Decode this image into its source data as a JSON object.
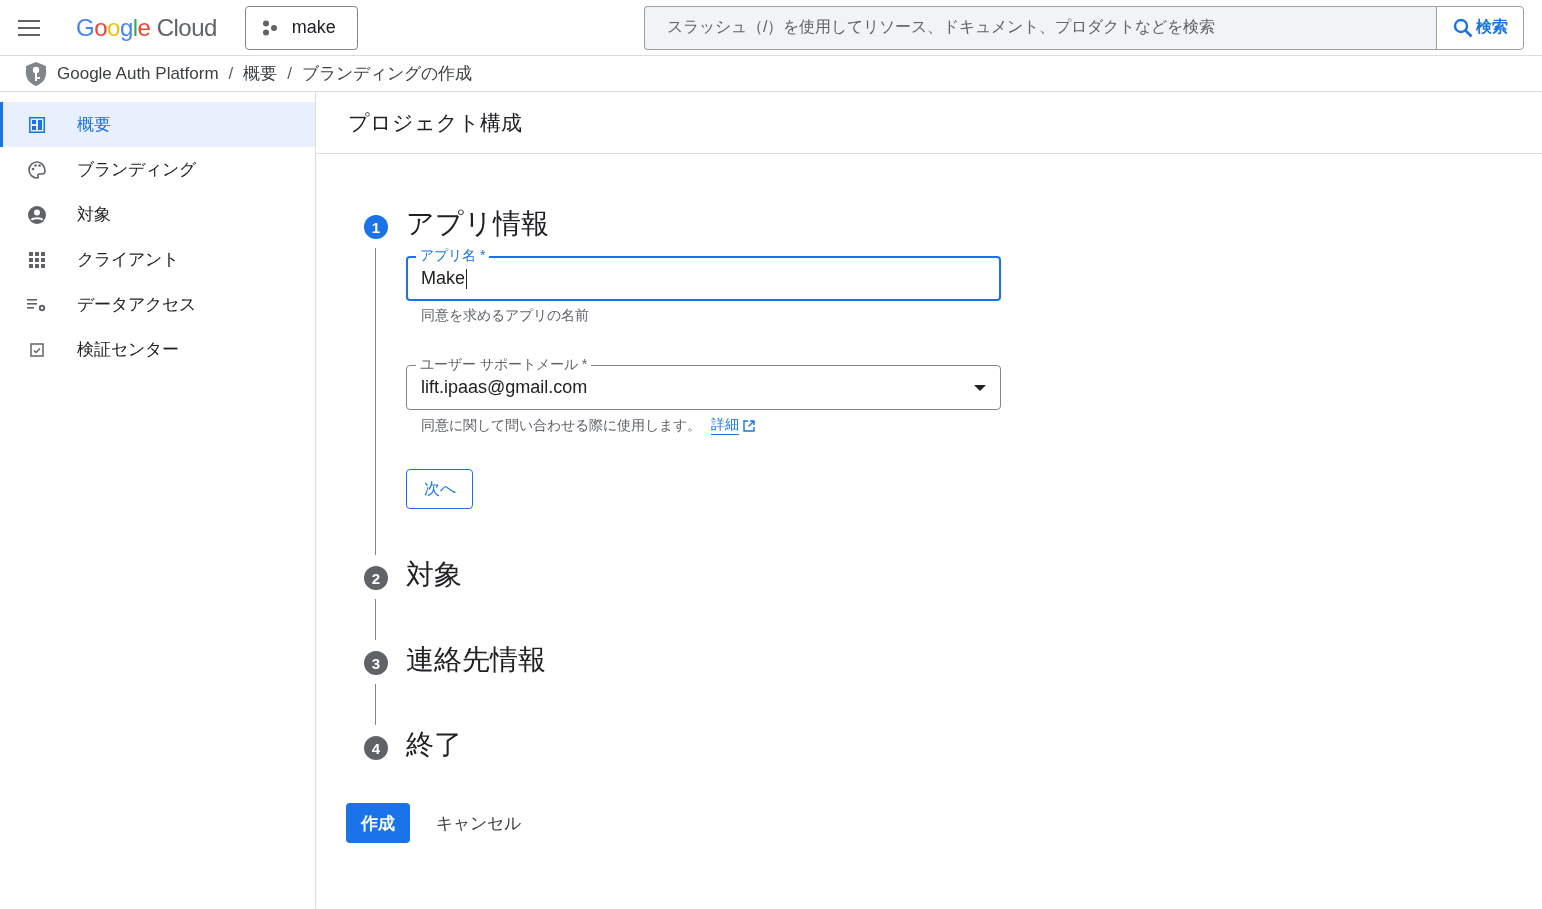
{
  "header": {
    "logo": {
      "brand": "Google",
      "product": "Cloud"
    },
    "project": "make",
    "search": {
      "placeholder": "スラッシュ（/）を使用してリソース、ドキュメント、プロダクトなどを検索",
      "button": "検索"
    }
  },
  "breadcrumb": {
    "separator": "/",
    "items": [
      "Google Auth Platform",
      "概要",
      "ブランディングの作成"
    ]
  },
  "sidebar": {
    "items": [
      {
        "label": "概要",
        "selected": true
      },
      {
        "label": "ブランディング",
        "selected": false
      },
      {
        "label": "対象",
        "selected": false
      },
      {
        "label": "クライアント",
        "selected": false
      },
      {
        "label": "データアクセス",
        "selected": false
      },
      {
        "label": "検証センター",
        "selected": false
      }
    ]
  },
  "page_title": "プロジェクト構成",
  "steps": [
    {
      "number": "1",
      "title": "アプリ情報",
      "selected": true
    },
    {
      "number": "2",
      "title": "対象",
      "selected": false
    },
    {
      "number": "3",
      "title": "連絡先情報",
      "selected": false
    },
    {
      "number": "4",
      "title": "終了",
      "selected": false
    }
  ],
  "form": {
    "app_name": {
      "label": "アプリ名 *",
      "value": "Make",
      "hint": "同意を求めるアプリの名前"
    },
    "support_email": {
      "label": "ユーザー サポートメール *",
      "value": "lift.ipaas@gmail.com",
      "hint": "同意に関して問い合わせる際に使用します。",
      "link": "詳細"
    },
    "next_button": "次へ"
  },
  "actions": {
    "create": "作成",
    "cancel": "キャンセル"
  }
}
